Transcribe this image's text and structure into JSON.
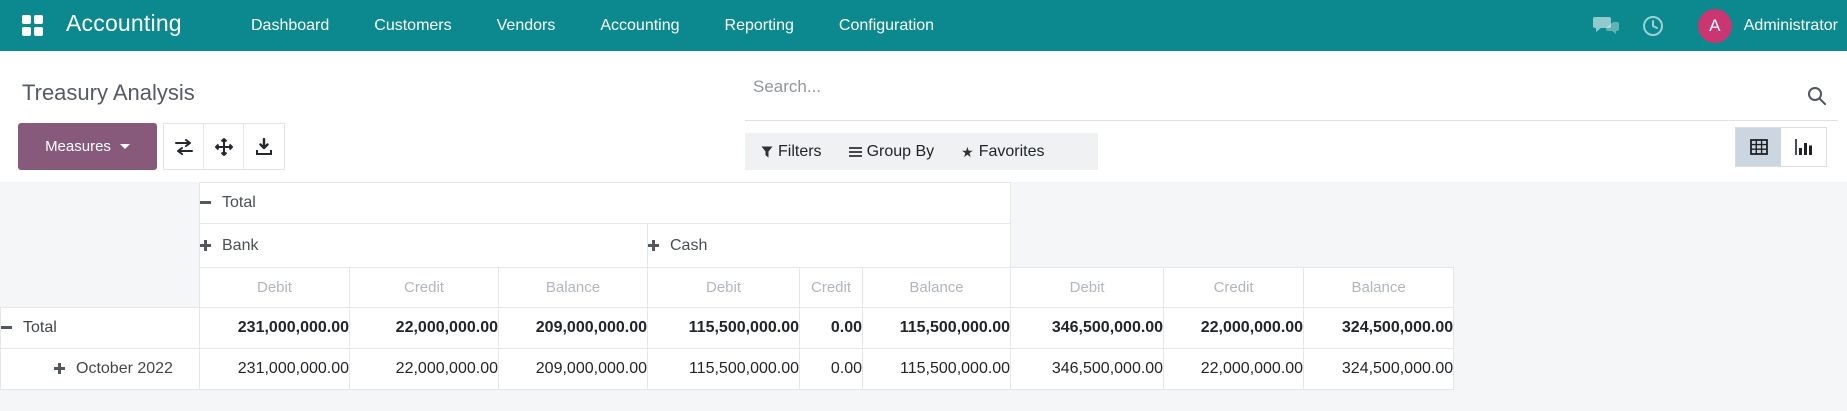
{
  "navbar": {
    "brand": "Accounting",
    "menu": [
      "Dashboard",
      "Customers",
      "Vendors",
      "Accounting",
      "Reporting",
      "Configuration"
    ],
    "user_initial": "A",
    "user_name": "Administrator"
  },
  "control_panel": {
    "title": "Treasury Analysis",
    "measures_button": "Measures",
    "search_placeholder": "Search...",
    "filters_label": "Filters",
    "group_by_label": "Group By",
    "favorites_label": "Favorites"
  },
  "pivot": {
    "column_root_label": "Total",
    "column_groups": [
      {
        "label": "Bank"
      },
      {
        "label": "Cash"
      }
    ],
    "measures": [
      "Debit",
      "Credit",
      "Balance"
    ],
    "rows": [
      {
        "label": "Total",
        "state": "expanded",
        "values": [
          "231,000,000.00",
          "22,000,000.00",
          "209,000,000.00",
          "115,500,000.00",
          "0.00",
          "115,500,000.00",
          "346,500,000.00",
          "22,000,000.00",
          "324,500,000.00"
        ]
      },
      {
        "label": "October 2022",
        "state": "collapsed",
        "values": [
          "231,000,000.00",
          "22,000,000.00",
          "209,000,000.00",
          "115,500,000.00",
          "0.00",
          "115,500,000.00",
          "346,500,000.00",
          "22,000,000.00",
          "324,500,000.00"
        ]
      }
    ]
  },
  "colors": {
    "navbar_bg": "#0c898e",
    "accent_purple": "#875a7b",
    "avatar_bg": "#ca3672",
    "content_bg": "#f5f6f7",
    "filter_bar_bg": "#eff1f3",
    "active_view_bg": "#ccd6e0"
  }
}
